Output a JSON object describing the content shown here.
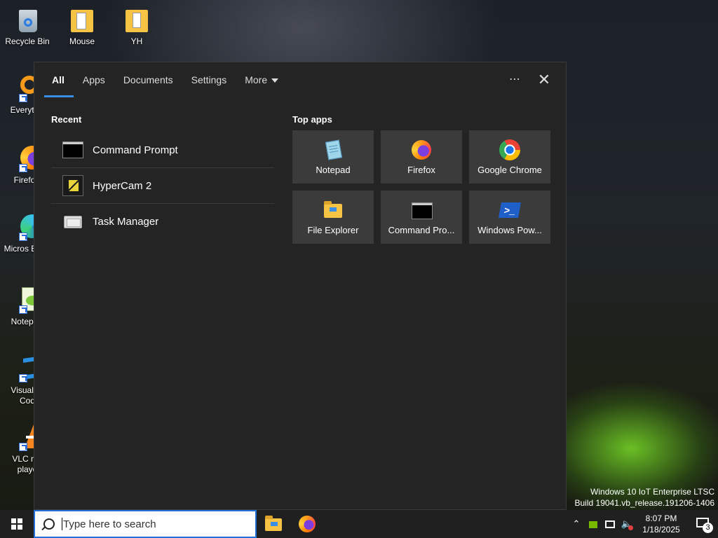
{
  "desktop": {
    "icons": [
      {
        "label": "Recycle Bin"
      },
      {
        "label": "Mouse"
      },
      {
        "label": "YH"
      },
      {
        "label": "Everyth"
      },
      {
        "label": "Firefo"
      },
      {
        "label": "Micros Edge"
      },
      {
        "label": "Notepa"
      },
      {
        "label": "Visual St Cod"
      },
      {
        "label": "VLC me playe"
      }
    ],
    "watermark": {
      "line1": "Windows 10 IoT Enterprise LTSC",
      "line2": "Build 19041.vb_release.191206-1406"
    }
  },
  "search_panel": {
    "tabs": [
      {
        "label": "All",
        "active": true
      },
      {
        "label": "Apps"
      },
      {
        "label": "Documents"
      },
      {
        "label": "Settings"
      },
      {
        "label": "More"
      }
    ],
    "more_icon": "ellipsis-icon",
    "close_icon": "close-icon",
    "recent": {
      "title": "Recent",
      "items": [
        {
          "label": "Command Prompt",
          "icon": "command-prompt-icon"
        },
        {
          "label": "HyperCam 2",
          "icon": "hypercam-icon"
        },
        {
          "label": "Task Manager",
          "icon": "task-manager-icon"
        }
      ]
    },
    "top_apps": {
      "title": "Top apps",
      "items": [
        {
          "label": "Notepad",
          "icon": "notepad-icon"
        },
        {
          "label": "Firefox",
          "icon": "firefox-icon"
        },
        {
          "label": "Google Chrome",
          "icon": "chrome-icon"
        },
        {
          "label": "File Explorer",
          "icon": "file-explorer-icon"
        },
        {
          "label": "Command Pro...",
          "icon": "command-prompt-icon"
        },
        {
          "label": "Windows Pow...",
          "icon": "powershell-icon"
        }
      ]
    }
  },
  "taskbar": {
    "search_placeholder": "Type here to search",
    "pinned": [
      {
        "name": "File Explorer",
        "icon": "file-explorer-icon"
      },
      {
        "name": "Firefox",
        "icon": "firefox-icon"
      }
    ],
    "clock": {
      "time": "8:07 PM",
      "date": "1/18/2025"
    },
    "notification_count": "3"
  },
  "colors": {
    "accent": "#3a8ee6",
    "panel_bg": "#242424",
    "tile_bg": "#3b3b3b",
    "taskbar_bg": "#202020"
  }
}
